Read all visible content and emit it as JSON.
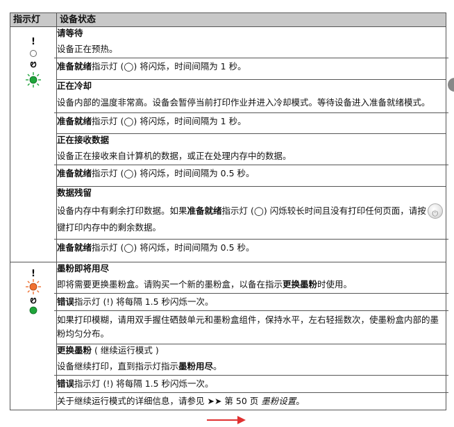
{
  "header": {
    "col1": "指示灯",
    "col2": "设备状态"
  },
  "group1": {
    "s1": {
      "title": "请等待",
      "desc": "设备正在预热。",
      "tag": "准备就绪",
      "tail": "指示灯 (◯) 将闪烁，时间间隔为 1 秒。"
    },
    "s2": {
      "title": "正在冷却",
      "desc": "设备内部的温度非常高。设备会暂停当前打印作业并进入冷却模式。等待设备进入准备就绪模式。",
      "tag": "准备就绪",
      "tail": "指示灯 (◯) 将闪烁，时间间隔为 1 秒。"
    },
    "s3": {
      "title": "正在接收数据",
      "desc": "设备正在接收来自计算机的数据，或正在处理内存中的数据。",
      "tag": "准备就绪",
      "tail": "指示灯 (◯) 将闪烁，时间间隔为 0.5 秒。"
    },
    "s4": {
      "title": "数据残留",
      "desc_a": "设备内存中有剩余打印数据。如果",
      "desc_tag": "准备就绪",
      "desc_b": "指示灯 (◯) 闪烁较长时间且没有打印任何页面，请按",
      "desc_c": "键打印内存中的剩余数据。",
      "tag": "准备就绪",
      "tail": "指示灯 (◯) 将闪烁，时间间隔为 0.5 秒。"
    }
  },
  "group2": {
    "s1": {
      "title": "墨粉即将用尽",
      "desc_a": "即将需要更换墨粉盒。请购买一个新的墨粉盒，以备在指示",
      "desc_tag": "更换墨粉",
      "desc_b": "时使用。",
      "tag": "错误",
      "tail": "指示灯 (!) 将每隔 1.5 秒闪烁一次。",
      "desc2": "如果打印模糊，请用双手握住硒鼓单元和墨粉盒组件，保持水平，左右轻摇数次，使墨粉盒内部的墨粉均匀分布。"
    },
    "s2": {
      "title": "更换墨粉",
      "title_suffix": " ( 继续运行模式 )",
      "desc_a": "设备继续打印，直到指示灯指示",
      "desc_tag": "墨粉用尽",
      "desc_b": "。",
      "tag": "错误",
      "tail": "指示灯 (!) 将每隔 1.5 秒闪烁一次。",
      "ref_a": "关于继续运行模式的详细信息，请参见 ➤➤ 第 50 页 ",
      "ref_i": "墨粉设置",
      "ref_b": "。"
    }
  },
  "colors": {
    "header_bg": "#c8c8c8",
    "green": "#1fa53a",
    "orange": "#f07030",
    "arrow": "#e03030"
  }
}
